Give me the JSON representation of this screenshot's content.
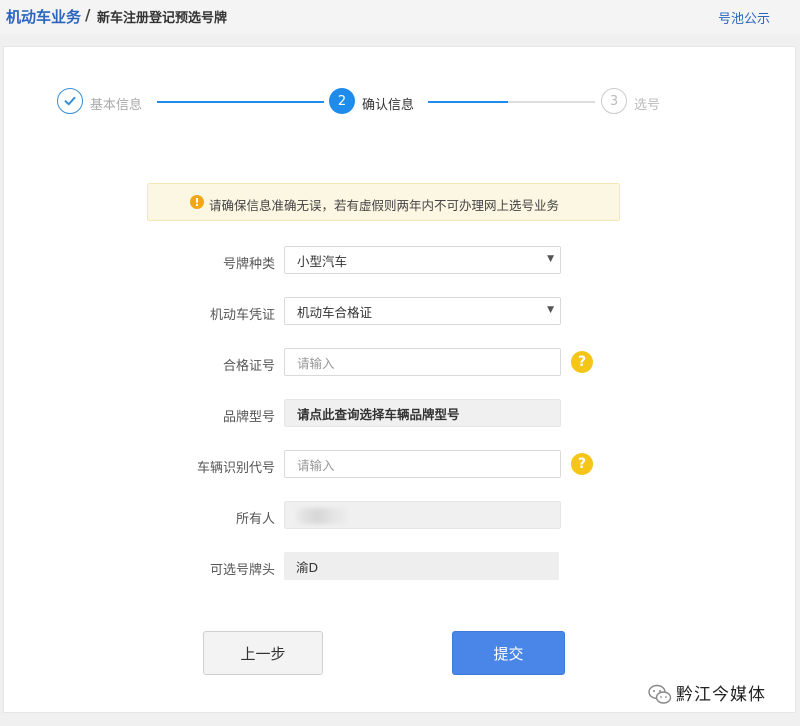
{
  "breadcrumb": {
    "main": "机动车业务",
    "separator": "/",
    "page": "新车注册登记预选号牌"
  },
  "header_link": "号池公示",
  "steps": [
    {
      "number": "",
      "label": "基本信息",
      "state": "done"
    },
    {
      "number": "2",
      "label": "确认信息",
      "state": "active"
    },
    {
      "number": "3",
      "label": "选号",
      "state": "pending"
    }
  ],
  "notice": {
    "icon": "!",
    "text": "请确保信息准确无误，若有虚假则两年内不可办理网上选号业务"
  },
  "form": {
    "plate_type": {
      "label": "号牌种类",
      "value": "小型汽车"
    },
    "vehicle_doc": {
      "label": "机动车凭证",
      "value": "机动车合格证"
    },
    "cert_no": {
      "label": "合格证号",
      "placeholder": "请输入"
    },
    "brand_model": {
      "label": "品牌型号",
      "value": "请点此查询选择车辆品牌型号"
    },
    "vin": {
      "label": "车辆识别代号",
      "placeholder": "请输入"
    },
    "owner": {
      "label": "所有人",
      "value": ""
    },
    "plate_prefix": {
      "label": "可选号牌头",
      "value": "渝D"
    }
  },
  "help_icon": "?",
  "buttons": {
    "prev": "上一步",
    "submit": "提交"
  },
  "watermark": "黔江今媒体",
  "colors": {
    "primary": "#2b65c0",
    "step_active": "#1f8ceb",
    "submit": "#4a86e8",
    "help": "#f5c518",
    "notice_icon": "#f2a71b"
  }
}
